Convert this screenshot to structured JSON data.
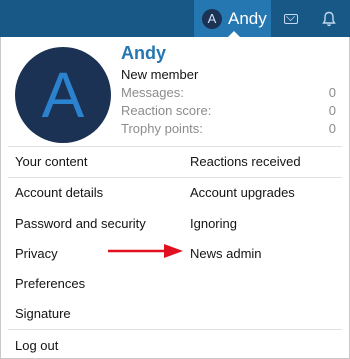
{
  "topbar": {
    "user_avatar_letter": "A",
    "user_name": "Andy",
    "inbox_icon": "envelope-icon",
    "alerts_icon": "bell-icon"
  },
  "profile": {
    "avatar_letter": "A",
    "name": "Andy",
    "title": "New member",
    "stats": [
      {
        "label": "Messages:",
        "value": "0"
      },
      {
        "label": "Reaction score:",
        "value": "0"
      },
      {
        "label": "Trophy points:",
        "value": "0"
      }
    ]
  },
  "menu": {
    "your_content": "Your content",
    "reactions_received": "Reactions received",
    "account_details": "Account details",
    "account_upgrades": "Account upgrades",
    "password_security": "Password and security",
    "ignoring": "Ignoring",
    "privacy": "Privacy",
    "news_admin": "News admin",
    "preferences": "Preferences",
    "signature": "Signature",
    "log_out": "Log out"
  },
  "colors": {
    "navbar": "#185886",
    "active_tab": "#2577b1",
    "username": "#2577b1",
    "avatar_bg": "#1b3254",
    "arrow": "#e01020"
  }
}
